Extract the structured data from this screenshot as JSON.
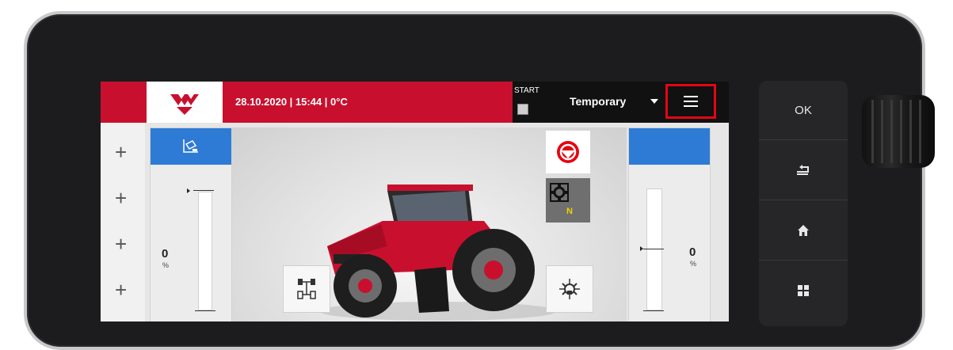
{
  "topbar": {
    "datetime": "28.10.2020 | 15:44 | 0°C",
    "start_label": "START",
    "profile_name": "Temporary"
  },
  "left_gauge": {
    "value": "0",
    "unit": "%"
  },
  "right_gauge": {
    "value": "0",
    "unit": "%"
  },
  "center_tiles": {
    "gear_indicator": "N"
  },
  "hard_keys": {
    "ok": "OK"
  },
  "colors": {
    "brand_red": "#c8102e",
    "highlight_red": "#e30613",
    "accent_blue": "#2e7bd6",
    "gear_yellow": "#f3d000"
  },
  "icons": [
    "massey-ferguson-logo",
    "start-icon",
    "dropdown-arrow-icon",
    "menu-icon",
    "plus-icon",
    "hitch-icon",
    "steering-wheel-icon",
    "gear-icon",
    "four-wheel-drive-icon",
    "diff-lock-icon",
    "back-icon",
    "home-icon",
    "grid-icon"
  ]
}
